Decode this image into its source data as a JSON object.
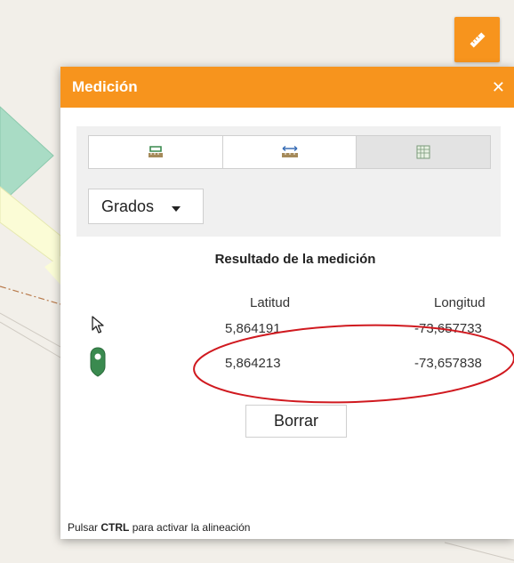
{
  "panel": {
    "title": "Medición",
    "close_label": "✕"
  },
  "mode_tabs": [
    {
      "name": "location-tool",
      "icon": "pin-ruler-icon"
    },
    {
      "name": "distance-tool",
      "icon": "distance-ruler-icon"
    },
    {
      "name": "area-tool",
      "icon": "area-grid-icon"
    }
  ],
  "units": {
    "selected": "Grados",
    "caret": "▼"
  },
  "result": {
    "title": "Resultado de la medición",
    "col_lat": "Latitud",
    "col_lon": "Longitud",
    "rows": [
      {
        "icon": "cursor-arrow-icon",
        "lat": "5,864191",
        "lon": "-73,657733"
      },
      {
        "icon": "map-pin-icon",
        "lat": "5,864213",
        "lon": "-73,657838"
      }
    ]
  },
  "clear_button": "Borrar",
  "footer": {
    "prefix": "Pulsar ",
    "key": "CTRL",
    "suffix": " para activar la alineación"
  },
  "colors": {
    "accent": "#f7941d",
    "pin_green": "#3a8a4f",
    "annotation_red": "#d0191f"
  }
}
